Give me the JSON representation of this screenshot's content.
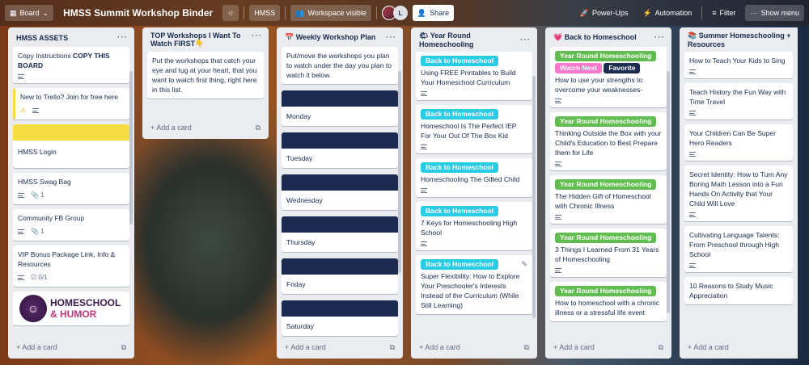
{
  "topbar": {
    "view_label": "Board",
    "board_title": "HMSS Summit Workshop Binder",
    "workspace_name": "HMSS",
    "visibility_label": "Workspace visible",
    "member_initial": "L",
    "share_label": "Share",
    "powerups_label": "Power-Ups",
    "automation_label": "Automation",
    "filter_label": "Filter",
    "show_menu_label": "Show menu"
  },
  "lists": [
    {
      "title": "HMSS ASSETS",
      "cards": [
        {
          "text": "Copy Instructions ",
          "bold": "COPY THIS BOARD"
        },
        {
          "text": "New to Trello? Join for free here"
        },
        {
          "text": "HMSS Login"
        },
        {
          "text": "HMSS Swag Bag",
          "attachments": "1"
        },
        {
          "text": "Community FB Group",
          "attachments": "1"
        },
        {
          "text": "VIP Bonus Package Link, Info & Resources",
          "checklist": "0/1"
        },
        {
          "logo_line1": "HOMESCHOOL",
          "logo_line2": "& HUMOR"
        }
      ],
      "add_label": "Add a card"
    },
    {
      "title": "TOP Workshops I Want To Watch FIRST👇",
      "cards": [
        {
          "text": "Put the workshops that catch your eye and tug at your heart, that you want to watch first thing, right here in this list."
        }
      ],
      "add_label": "Add a card"
    },
    {
      "title": "📅 Weekly Workshop Plan",
      "cards": [
        {
          "text": "Put/move the workshops you plan to watch under the day you plan to watch it below."
        },
        {
          "text": "Monday"
        },
        {
          "text": "Tuesday"
        },
        {
          "text": "Wednesday"
        },
        {
          "text": "Thursday"
        },
        {
          "text": "Friday"
        },
        {
          "text": "Saturday"
        }
      ],
      "add_label": "Add a card"
    },
    {
      "title": "🌤 Year Round Homeschooling",
      "cards": [
        {
          "label": "Back to Homeschool",
          "text": "Using FREE Printables to Build Your Homeschool Curriculum"
        },
        {
          "label": "Back to Homeschool",
          "text": "Homeschool Is The Perfect IEP For Your Out Of The Box Kid"
        },
        {
          "label": "Back to Homeschool",
          "text": "Homeschooling The Gifted Child"
        },
        {
          "label": "Back to Homeschool",
          "text": "7 Keys for Homeschooling High School"
        },
        {
          "label": "Back to Homeschool",
          "text": "Super Flexibility: How to Explore Your Preschooler's Interests Instead of the Curriculum (While Still Learning)"
        }
      ],
      "add_label": "Add a card"
    },
    {
      "title": "💗 Back to Homeschool",
      "cards": [
        {
          "label": "Year Round Homeschooling",
          "label2": "Watch Next",
          "label3": "Favorite",
          "text": "How to use your strengths to overcome your weaknesses-"
        },
        {
          "label": "Year Round Homeschooling",
          "text": "Thinking Outside the Box with your Child's Education to Best Prepare them for Life"
        },
        {
          "label": "Year Round Homeschooling",
          "text": "The Hidden Gift of Homeschool with Chronic Illness"
        },
        {
          "label": "Year Round Homeschooling",
          "text": "3 Things I Learned From 31 Years of Homeschooling"
        },
        {
          "label": "Year Round Homeschooling",
          "text": "How to homeschool with a chronic illness or a stressful life event"
        }
      ],
      "add_label": "Add a card"
    },
    {
      "title": "📚 Summer Homeschooling + Resources",
      "cards": [
        {
          "text": "How to Teach Your Kids to Sing"
        },
        {
          "text": "Teach History the Fun Way with Time Travel"
        },
        {
          "text": "Your Children Can Be Super Hero Readers"
        },
        {
          "text": "Secret Identity: How to Turn Any Boring Math Lesson into a Fun Hands On Activity that Your Child Will Love"
        },
        {
          "text": "Cultivating Language Talents: From Preschool through High School"
        },
        {
          "text": "10 Reasons to Study Music Appreciation"
        }
      ],
      "add_label": "Add a card"
    }
  ],
  "colors": {
    "label_cyan": "#29cce5",
    "label_green": "#61bd4f",
    "label_pink": "#ff78cb",
    "label_navy": "#1d2a4f",
    "cover_yellow": "#f5dd41"
  }
}
